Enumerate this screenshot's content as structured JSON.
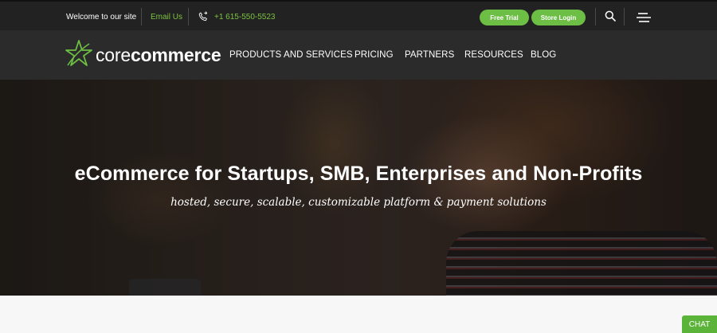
{
  "topbar": {
    "welcome": "Welcome to our site",
    "email_label": "Email Us",
    "phone": "+1 615-550-5523",
    "free_trial": "Free Trial",
    "store_login": "Store Login"
  },
  "logo": {
    "light": "core",
    "bold": "commerce"
  },
  "nav": {
    "items": [
      "PRODUCTS AND SERVICES",
      "PRICING",
      "PARTNERS",
      "RESOURCES",
      "BLOG"
    ]
  },
  "hero": {
    "title": "eCommerce for Startups, SMB, Enterprises and Non-Profits",
    "subtitle": "hosted, secure, scalable, customizable platform & payment solutions"
  },
  "chat": {
    "label": "CHAT"
  },
  "colors": {
    "accent_green": "#6dbe45",
    "topbar_bg": "#222222",
    "navbar_bg": "#2b2b2b"
  },
  "icons": [
    "phone-icon",
    "search-icon",
    "hamburger-menu-icon",
    "logo-star-icon"
  ]
}
